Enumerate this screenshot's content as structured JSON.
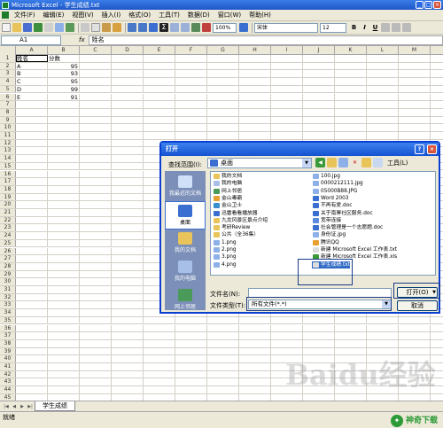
{
  "window": {
    "title": "Microsoft Excel - 学生成绩.txt"
  },
  "menu": [
    "文件(F)",
    "编辑(E)",
    "视图(V)",
    "插入(I)",
    "格式(O)",
    "工具(T)",
    "数据(D)",
    "窗口(W)",
    "帮助(H)"
  ],
  "toolbar": {
    "zoom": "100%",
    "font": "宋体",
    "size": "12",
    "bold": "B",
    "italic": "I",
    "underline": "U"
  },
  "formula": {
    "name_box": "A1",
    "fx": "fx",
    "content": "姓名"
  },
  "grid": {
    "columns": [
      "A",
      "B",
      "C",
      "D",
      "E",
      "F",
      "G",
      "H",
      "I",
      "J",
      "K",
      "L",
      "M"
    ],
    "row_numbers": [
      "1",
      "2",
      "3",
      "4",
      "5",
      "6",
      "7",
      "8",
      "9",
      "10",
      "11",
      "12",
      "13",
      "14",
      "15",
      "16",
      "17",
      "18",
      "19",
      "20",
      "21",
      "22",
      "23",
      "24",
      "25",
      "26",
      "27",
      "28",
      "29",
      "30",
      "31",
      "32",
      "33",
      "34",
      "35",
      "36",
      "37",
      "38",
      "39",
      "40",
      "41",
      "42",
      "43",
      "44",
      "45"
    ],
    "rows": [
      {
        "a": "姓名",
        "b": "分数"
      },
      {
        "a": "A",
        "b": "95"
      },
      {
        "a": "B",
        "b": "93"
      },
      {
        "a": "C",
        "b": "95"
      },
      {
        "a": "D",
        "b": "99"
      },
      {
        "a": "E",
        "b": "91"
      }
    ]
  },
  "sheet_tab": "学生成绩",
  "status": "就绪",
  "brand": "神奇下载",
  "watermark": "Baidu经验",
  "dialog": {
    "title": "打开",
    "look_in_label": "查找范围(I):",
    "look_in_value": "桌面",
    "tools_label": "工具(L)",
    "places": [
      "我最近的文档",
      "桌面",
      "我的文档",
      "我的电脑",
      "网上邻居"
    ],
    "files_col1": [
      "我的文档",
      "我的电脑",
      "网上邻居",
      "金山毒霸",
      "金山卫士",
      "迅雷看看播放器",
      "九龙风景区景点介绍",
      "考研Review",
      "公共（全36集）",
      "1.png",
      "2.png",
      "3.png",
      "4.png"
    ],
    "files_col2": [
      "100.jpg",
      "0000212111.jpg",
      "05000B88.JPG",
      "Word 2003",
      "不再有爱.doc",
      "关于南寨社区服务.doc",
      "宽带连接",
      "社会管理是一个志愿题.doc",
      "身份证.jpg",
      "腾讯QQ",
      "新建 Microsoft Excel 工作表.txt",
      "新建 Microsoft Excel 工作表.xls",
      "学生成绩.txt"
    ],
    "file_name_label": "文件名(N):",
    "file_name_value": "",
    "file_type_label": "文件类型(T):",
    "file_type_value": "所有文件(*.*)",
    "open_label": "打开(O)",
    "cancel_label": "取消"
  }
}
